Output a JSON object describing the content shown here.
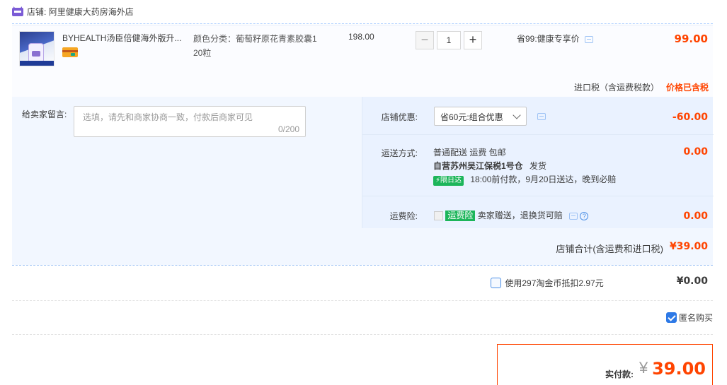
{
  "store": {
    "label": "店铺:",
    "name": "阿里健康大药房海外店"
  },
  "item": {
    "title": "BYHEALTH汤臣倍健海外版升...",
    "sku_line1": "颜色分类：葡萄籽原花青素胶囊1",
    "sku_line2": "20粒",
    "unit_price": "198.00",
    "quantity": "1",
    "minus": "−",
    "plus": "+",
    "discount": "省99:健康专享价",
    "total": "99.00",
    "tax_label": "进口税（含运费税款）",
    "tax_note": "价格已含税"
  },
  "note": {
    "label": "给卖家留言:",
    "placeholder": "选填，请先和商家协商一致，付款后商家可见",
    "count": "0/200"
  },
  "coupon": {
    "label": "店铺优惠:",
    "selected": "省60元:组合优惠",
    "amount": "-60.00"
  },
  "shipping": {
    "label": "运送方式:",
    "line1": "普通配送 运费 包邮",
    "line2_bold": "自营苏州吴江保税1号仓",
    "line2_rest": "发货",
    "badge": "隔日达",
    "line3": "18:00前付款，9月20日送达，晚到必赔",
    "amount": "0.00"
  },
  "insurance": {
    "label": "运费险:",
    "badge": "运费险",
    "text": "卖家赠送，退换货可赔",
    "help": "?",
    "amount": "0.00"
  },
  "store_total": {
    "label": "店铺合计(含运费和进口税)",
    "value": "¥39.00"
  },
  "coins": {
    "label": "使用297淘金币抵扣2.97元",
    "value": "¥0.00",
    "checked": false
  },
  "anonymous": {
    "label": "匿名购买",
    "checked": true
  },
  "payment": {
    "label": "实付款:",
    "currency": "¥",
    "value": "39.00"
  },
  "colors": {
    "price_red": "#ff4400",
    "accent_blue": "#2d79e6",
    "panel_bg": "#f2f7ff",
    "badge_green": "#1cb55a"
  }
}
